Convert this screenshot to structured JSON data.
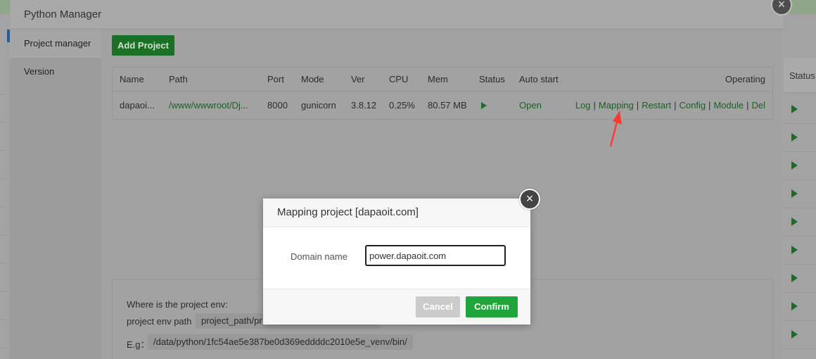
{
  "main_dialog": {
    "title": "Python Manager",
    "sidebar": [
      {
        "label": "Project manager"
      },
      {
        "label": "Version"
      }
    ],
    "add_project_label": "Add Project"
  },
  "table": {
    "headers": [
      "Name",
      "Path",
      "Port",
      "Mode",
      "Ver",
      "CPU",
      "Mem",
      "Status",
      "Auto start",
      "Operating"
    ],
    "rows": [
      {
        "name": "dapaoi...",
        "path": "/www/wwwroot/Dj...",
        "port": "8000",
        "mode": "gunicorn",
        "ver": "3.8.12",
        "cpu": "0.25%",
        "mem": "80.57 MB",
        "status_icon": "play-icon",
        "auto_start": "Open",
        "operations": [
          "Log",
          "Mapping",
          "Restart",
          "Config",
          "Module",
          "Del"
        ]
      }
    ]
  },
  "env_help": {
    "question": "Where is the project env:",
    "path_label": "project env path",
    "path_value": "project_path/pr",
    "example_label": "E.g：",
    "example_value": "/data/python/1fc54ae5e387be0d369eddddc2010e5e_venv/bin/"
  },
  "background": {
    "status_header": "Status"
  },
  "mapping_dialog": {
    "title": "Mapping project [dapaoit.com]",
    "domain_label": "Domain name",
    "domain_value": "power.dapaoit.com",
    "cancel_label": "Cancel",
    "confirm_label": "Confirm"
  },
  "colors": {
    "accent_green": "#20a53a",
    "link_green": "#1b5f24",
    "annotation_arrow": "#ff3b30"
  }
}
